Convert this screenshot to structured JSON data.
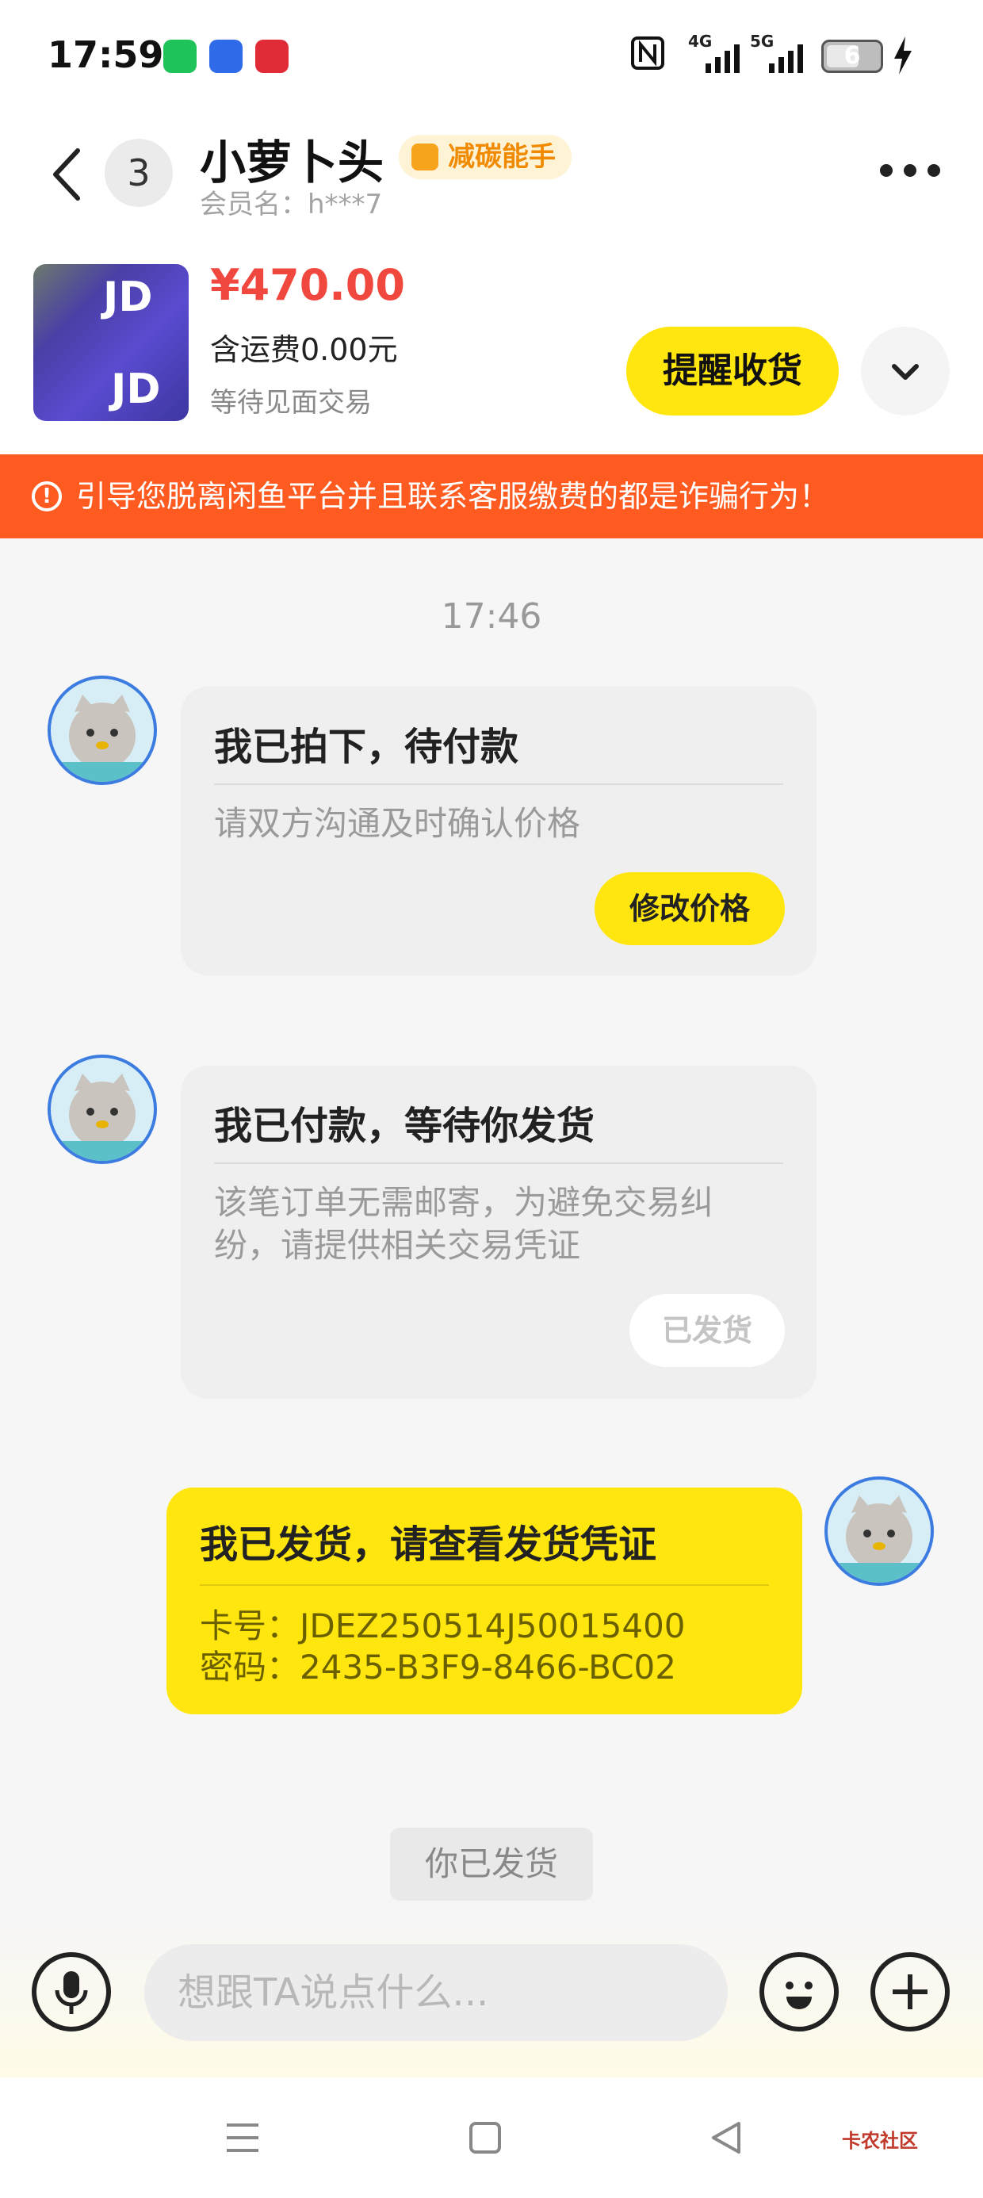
{
  "status_bar": {
    "time": "17:59",
    "network_1": "4G",
    "network_2": "5G",
    "battery": "6"
  },
  "header": {
    "unread_count": "3",
    "name": "小萝卜头",
    "badge": "减碳能手",
    "member": "会员名：h***7"
  },
  "product": {
    "thumb_text": "JD",
    "price": "¥470.00",
    "shipping": "含运费0.00元",
    "status": "等待见面交易",
    "remind_button": "提醒收货"
  },
  "warning": {
    "text": "引导您脱离闲鱼平台并且联系客服缴费的都是诈骗行为！"
  },
  "chat": {
    "timestamp": "17:46",
    "messages": [
      {
        "title": "我已拍下，待付款",
        "body": "请双方沟通及时确认价格",
        "button": "修改价格"
      },
      {
        "title": "我已付款，等待你发货",
        "body_line1": "该笔订单无需邮寄，为避免交易纠",
        "body_line2": "纷，请提供相关交易凭证",
        "button": "已发货"
      },
      {
        "title": "我已发货，请查看发货凭证",
        "card_no": "卡号：JDEZ250514J50015400",
        "password": "密码：2435-B3F9-8466-BC02"
      }
    ],
    "system_note": "你已发货"
  },
  "input": {
    "placeholder": "想跟TA说点什么..."
  },
  "watermark": "卡农社区",
  "colors": {
    "accent_yellow": "#ffe60f",
    "price_red": "#f0483e",
    "warning_orange": "#ff5a1f"
  }
}
